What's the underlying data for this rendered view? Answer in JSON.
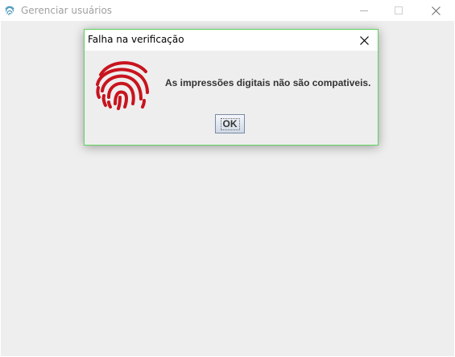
{
  "main_window": {
    "title": "Gerenciar usuários",
    "app_icon": "fingerprint-icon",
    "controls": [
      "minimize-icon",
      "maximize-icon",
      "close-icon"
    ]
  },
  "dialog": {
    "title": "Falha na verificação",
    "icon": "fingerprint-icon",
    "icon_color": "#c8141e",
    "message": "As impressões digitais não são compativeis.",
    "ok_label": "OK",
    "border_color": "#5fd35f"
  }
}
